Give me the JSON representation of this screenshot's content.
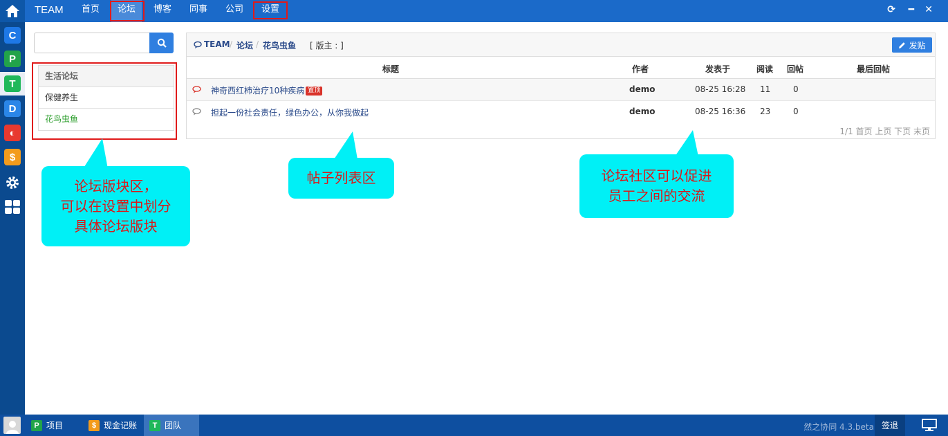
{
  "nav": {
    "brand": "TEAM",
    "items": [
      {
        "label": "首页"
      },
      {
        "label": "论坛"
      },
      {
        "label": "博客"
      },
      {
        "label": "同事"
      },
      {
        "label": "公司"
      },
      {
        "label": "设置"
      }
    ],
    "active": "论坛"
  },
  "sidebar_apps": [
    {
      "letter": "C",
      "color": "#1e78e6"
    },
    {
      "letter": "P",
      "color": "#22a34a"
    },
    {
      "letter": "T",
      "color": "#1fb85a"
    },
    {
      "letter": "D",
      "color": "#2a86e8"
    },
    {
      "letter": "◐",
      "color": "#e8392f"
    },
    {
      "letter": "$",
      "color": "#f39b1c"
    }
  ],
  "search": {
    "placeholder": "",
    "value": ""
  },
  "forums": {
    "header": "生活论坛",
    "items": [
      {
        "label": "保健养生"
      },
      {
        "label": "花鸟虫鱼"
      }
    ]
  },
  "breadcrumb": {
    "root": "TEAM",
    "section": "论坛",
    "current": "花鸟虫鱼",
    "moderator": "[ 版主 : ]"
  },
  "post_button": "发贴",
  "table": {
    "headers": {
      "title": "标题",
      "author": "作者",
      "posted": "发表于",
      "reads": "阅读",
      "replies": "回帖",
      "last_reply": "最后回帖"
    },
    "rows": [
      {
        "title": "神奇西红柿治疗10种疾病",
        "badge": "置顶",
        "author": "demo",
        "posted": "08-25 16:28",
        "reads": "11",
        "replies": "0",
        "last_reply": "",
        "icon_color": "#d9332a"
      },
      {
        "title": "担起一份社会责任，绿色办公，从你我做起",
        "badge": "",
        "author": "demo",
        "posted": "08-25 16:36",
        "reads": "23",
        "replies": "0",
        "last_reply": "",
        "icon_color": "#888888"
      }
    ]
  },
  "pager": "1/1 首页 上页 下页 末页",
  "callouts": {
    "forum_sections": [
      "论坛版块区，",
      "可以在设置中划分",
      "具体论坛版块"
    ],
    "post_list": [
      "帖子列表区"
    ],
    "community": [
      "论坛社区可以促进",
      "员工之间的交流"
    ]
  },
  "taskbar": {
    "tasks": [
      {
        "label": "项目",
        "letter": "P",
        "color": "#22a34a"
      },
      {
        "label": "现金记账",
        "letter": "$",
        "color": "#f39b1c"
      },
      {
        "label": "团队",
        "letter": "T",
        "color": "#1fb85a"
      }
    ],
    "version": "然之协同 4.3.beta",
    "signout": "签退"
  },
  "colors": {
    "nav": "#1b6ac9",
    "accent": "#2f7fe0",
    "annotation_bg": "#00f0f6",
    "annotation_text": "#d81a1a",
    "highlight_border": "#e01a1a"
  }
}
